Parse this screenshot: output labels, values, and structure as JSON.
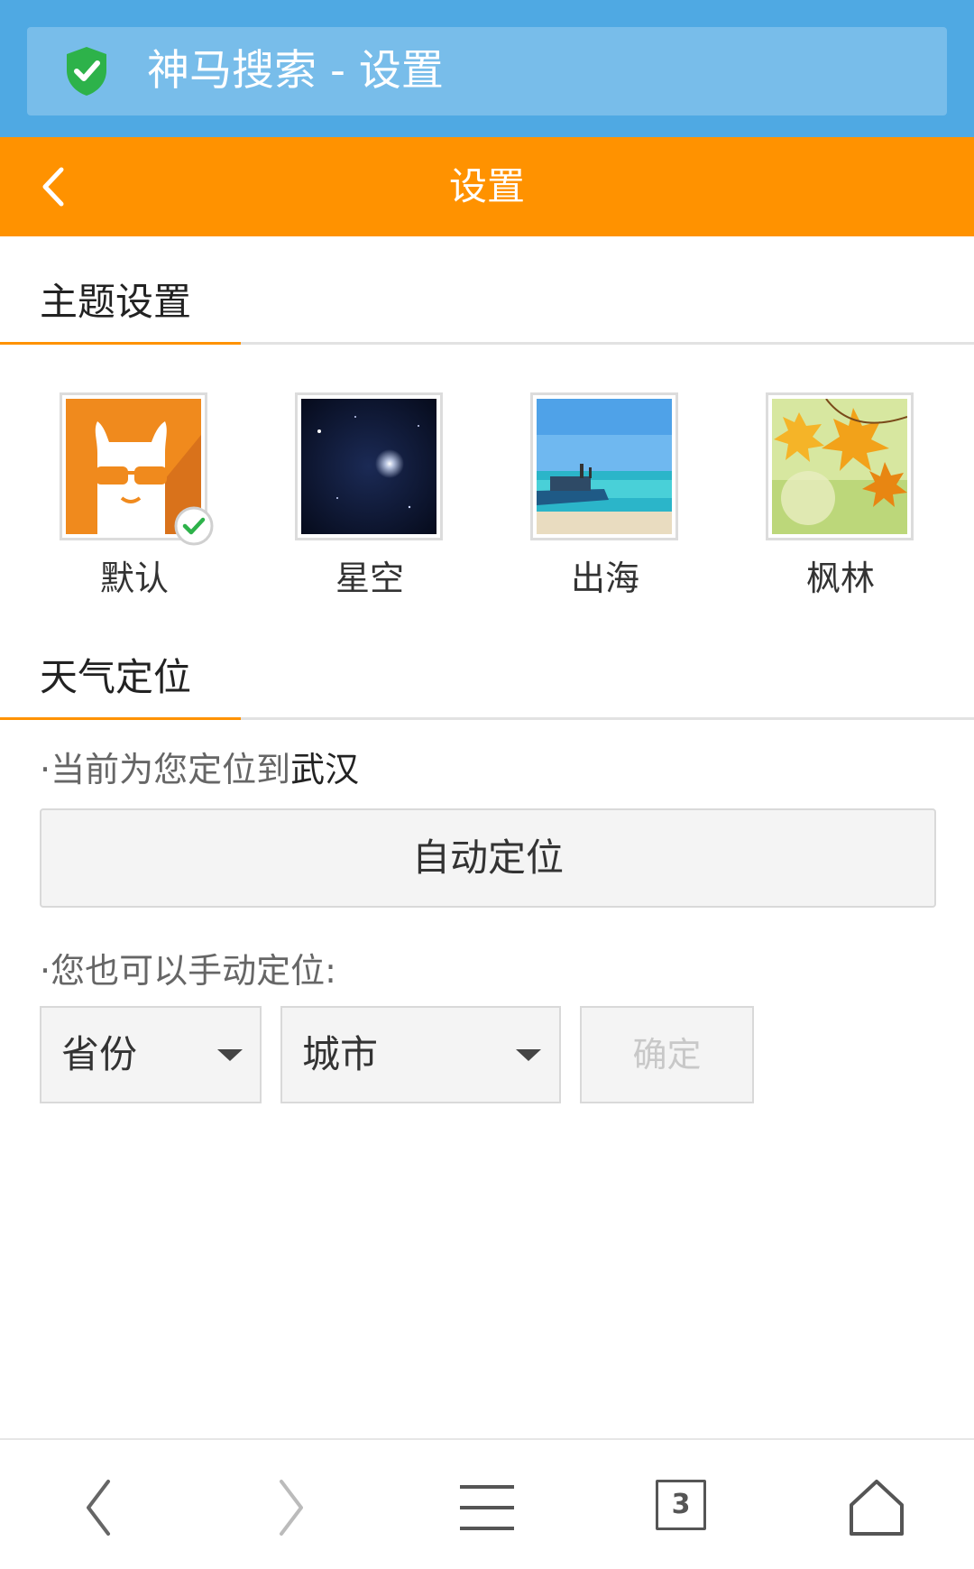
{
  "browser": {
    "title": "神马搜索 - 设置",
    "shield_icon": "shield-check-icon"
  },
  "header": {
    "title": "设置",
    "back_icon": "chevron-left-icon"
  },
  "theme_section": {
    "heading": "主题设置",
    "themes": [
      {
        "name": "默认",
        "selected": true
      },
      {
        "name": "星空",
        "selected": false
      },
      {
        "name": "出海",
        "selected": false
      },
      {
        "name": "枫林",
        "selected": false
      }
    ]
  },
  "weather_section": {
    "heading": "天气定位",
    "current_prefix": "·当前为您定位到",
    "current_city": "武汉",
    "auto_button": "自动定位",
    "manual_label": "·您也可以手动定位:",
    "province_select": "省份",
    "city_select": "城市",
    "confirm_button": "确定"
  },
  "bottom_nav": {
    "tab_count": "3",
    "icons": [
      "back-icon",
      "forward-icon",
      "menu-icon",
      "tabs-icon",
      "home-icon"
    ]
  },
  "colors": {
    "address_bar": "#4fa9e3",
    "header": "#ff9200",
    "accent": "#ff9200"
  }
}
